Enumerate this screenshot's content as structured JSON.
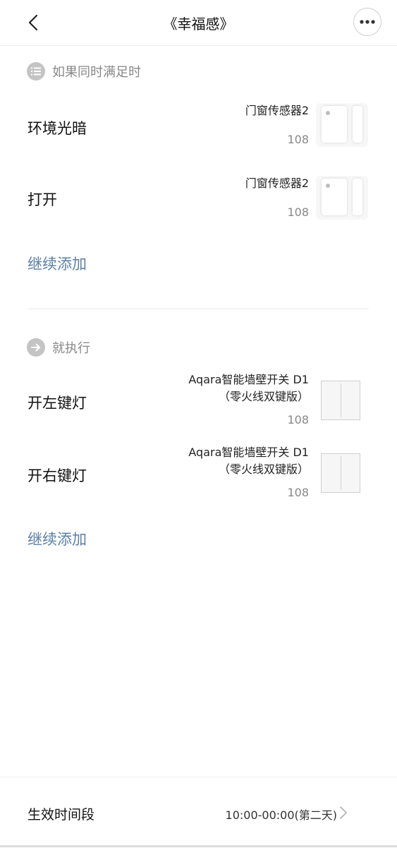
{
  "header": {
    "title": "《幸福感》",
    "back_icon": "chevron-left-icon",
    "more_icon": "more-horizontal-icon"
  },
  "conditions": {
    "section_label": "如果同时满足时",
    "section_icon": "list-icon",
    "items": [
      {
        "label": "环境光暗",
        "device_name": "门窗传感器2",
        "room": "108",
        "thumb": "door-window-sensor-image"
      },
      {
        "label": "打开",
        "device_name": "门窗传感器2",
        "room": "108",
        "thumb": "door-window-sensor-image"
      }
    ],
    "add_label": "继续添加"
  },
  "actions": {
    "section_label": "就执行",
    "section_icon": "arrow-right-icon",
    "items": [
      {
        "label": "开左键灯",
        "device_name_line1": "Aqara智能墙壁开关 D1",
        "device_name_line2": "（零火线双键版）",
        "room": "108",
        "thumb": "wall-switch-image"
      },
      {
        "label": "开右键灯",
        "device_name_line1": "Aqara智能墙壁开关 D1",
        "device_name_line2": "（零火线双键版）",
        "room": "108",
        "thumb": "wall-switch-image"
      }
    ],
    "add_label": "继续添加"
  },
  "footer": {
    "label": "生效时间段",
    "value": "10:00-00:00(第二天)",
    "chevron_icon": "chevron-right-icon"
  },
  "colors": {
    "link": "#5b7fa6",
    "section_text": "#888888",
    "icon_bg": "#c4c4c4"
  }
}
